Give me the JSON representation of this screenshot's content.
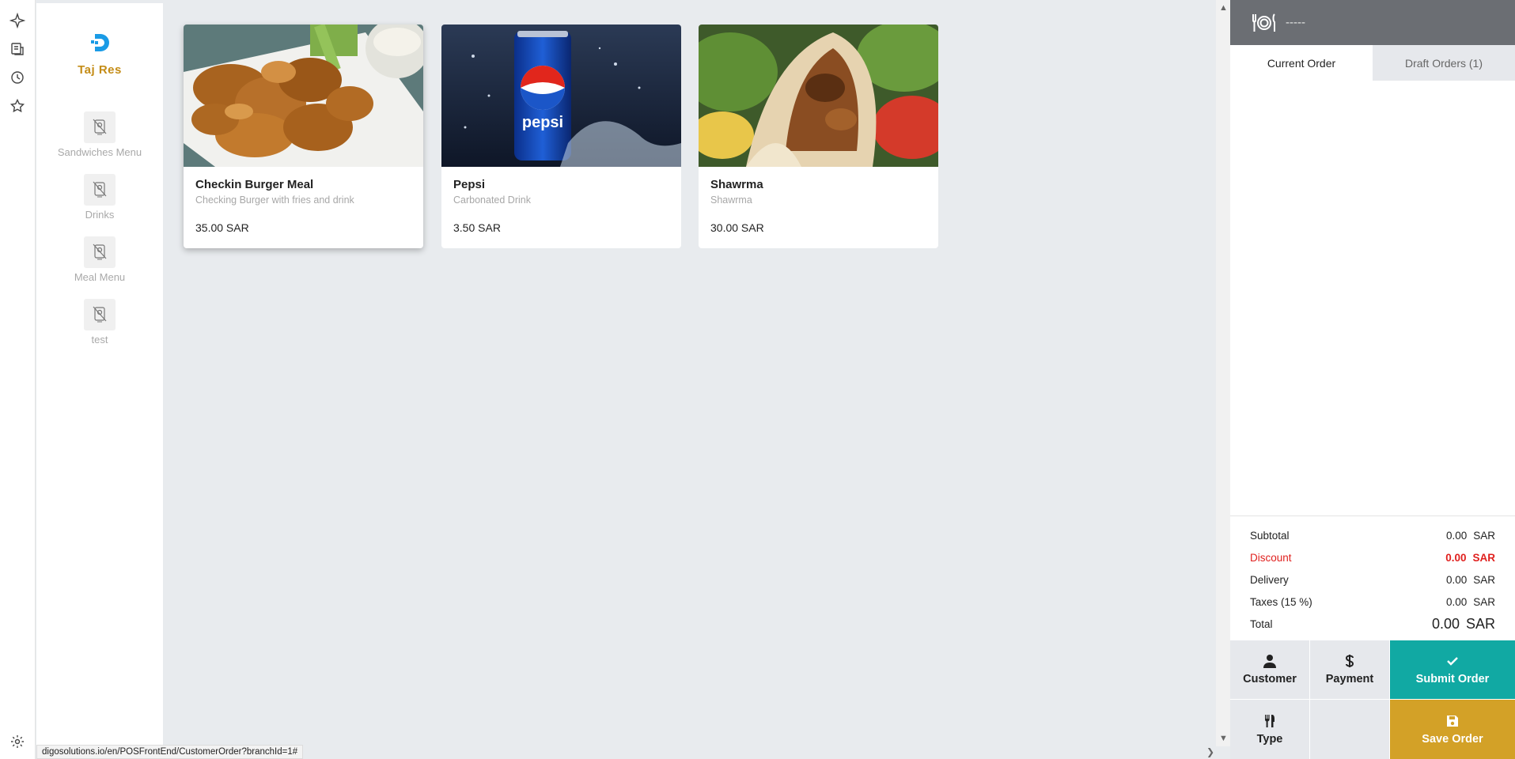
{
  "brand": {
    "name": "Taj Res"
  },
  "categories": [
    {
      "label": "Sandwiches Menu",
      "icon": "no-image-icon"
    },
    {
      "label": "Drinks",
      "icon": "no-image-icon"
    },
    {
      "label": "Meal Menu",
      "icon": "no-image-icon"
    },
    {
      "label": "test",
      "icon": "no-image-icon"
    }
  ],
  "products": [
    {
      "name": "Checkin Burger Meal",
      "description": "Checking Burger with fries and drink",
      "price": "35.00 SAR"
    },
    {
      "name": "Pepsi",
      "description": "Carbonated Drink",
      "price": "3.50 SAR"
    },
    {
      "name": "Shawrma",
      "description": "Shawrma",
      "price": "30.00 SAR"
    }
  ],
  "order": {
    "table_label": "-----",
    "tabs": {
      "current": "Current Order",
      "draft": "Draft Orders (1)"
    },
    "totals": {
      "subtotal": {
        "label": "Subtotal",
        "value": "0.00",
        "currency": "SAR"
      },
      "discount": {
        "label": "Discount",
        "value": "0.00",
        "currency": "SAR"
      },
      "delivery": {
        "label": "Delivery",
        "value": "0.00",
        "currency": "SAR"
      },
      "taxes": {
        "label": "Taxes (15 %)",
        "value": "0.00",
        "currency": "SAR"
      },
      "total": {
        "label": "Total",
        "value": "0.00",
        "currency": "SAR"
      }
    },
    "actions": {
      "customer": "Customer",
      "payment": "Payment",
      "submit": "Submit Order",
      "type": "Type",
      "save": "Save Order"
    }
  },
  "status_url": "digosolutions.io/en/POSFrontEnd/CustomerOrder?branchId=1#",
  "colors": {
    "brand_gold": "#c48c16",
    "submit_teal": "#11a9a3",
    "save_gold": "#d3a127",
    "discount_red": "#e0201e",
    "header_grey": "#6b6e73"
  }
}
